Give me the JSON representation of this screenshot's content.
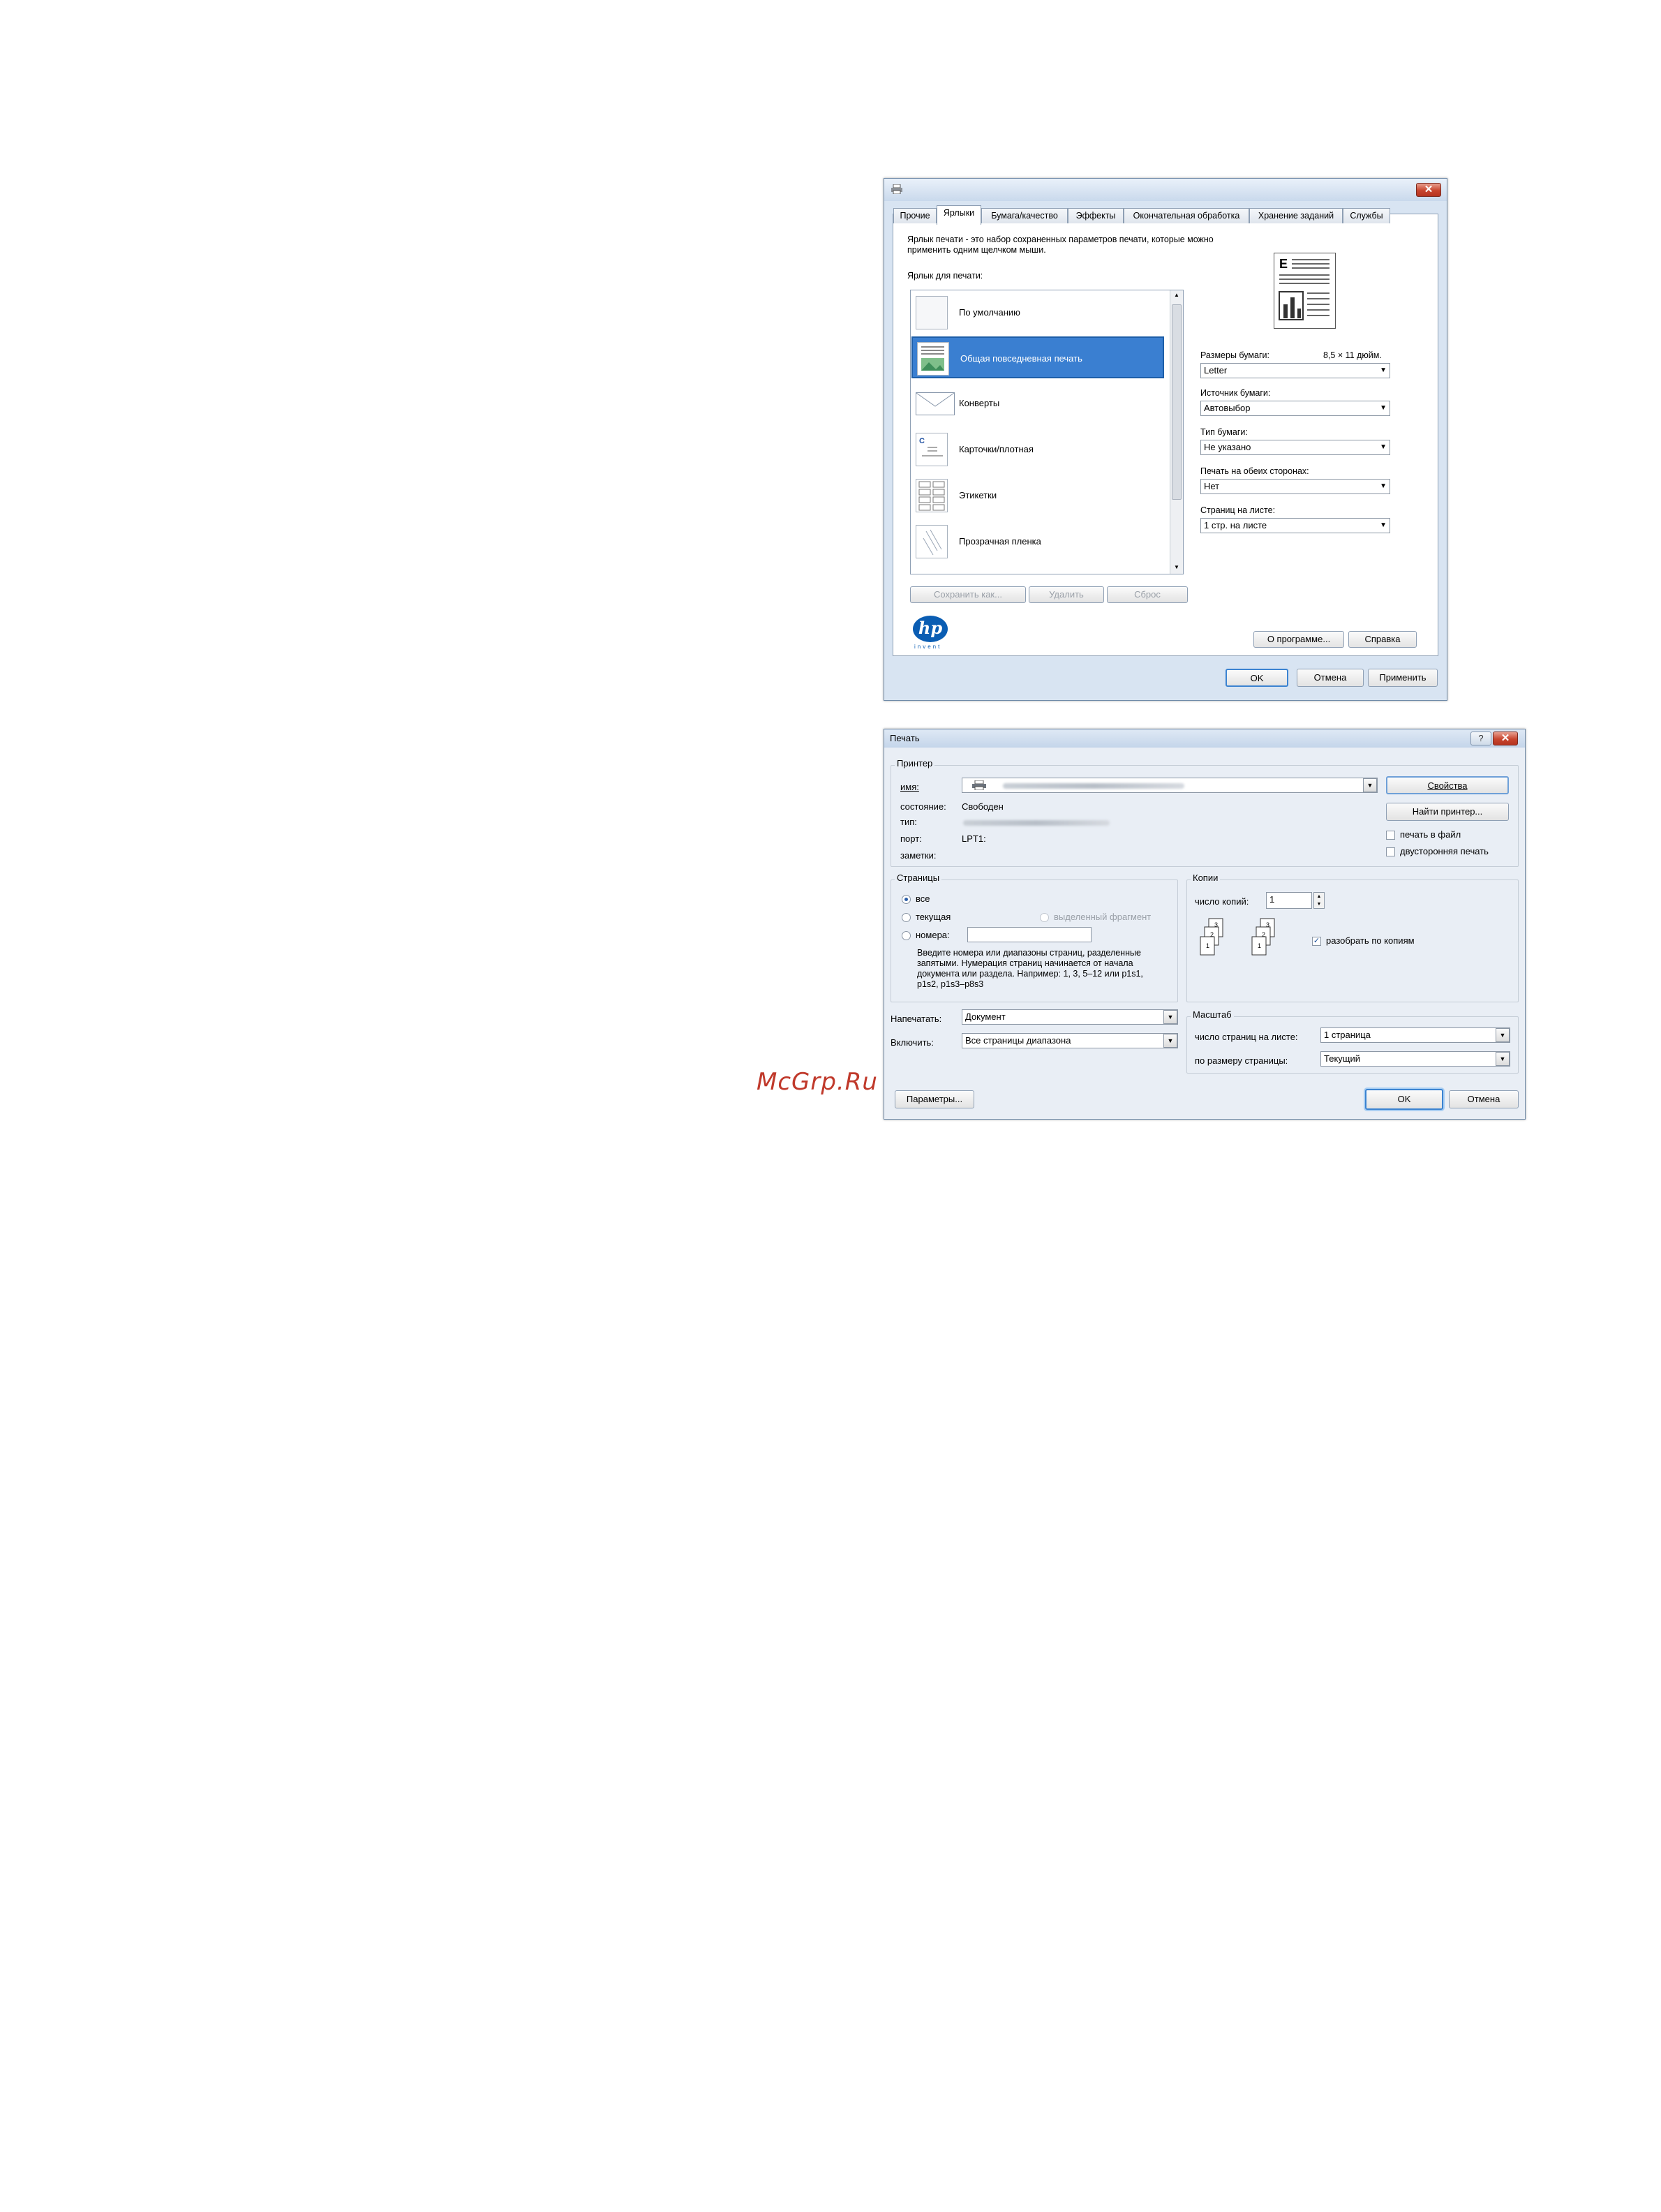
{
  "watermark": "McGrp.Ru",
  "hp_dialog": {
    "tabs": [
      "Прочие",
      "Ярлыки",
      "Бумага/качество",
      "Эффекты",
      "Окончательная обработка",
      "Хранение заданий",
      "Службы"
    ],
    "active_tab": "Ярлыки",
    "description": "Ярлык печати - это набор сохраненных параметров печати, которые можно применить одним щелчком мыши.",
    "shortcuts_label": "Ярлык для печати:",
    "shortcuts": [
      {
        "label": "По умолчанию",
        "icon": "blank-page-icon"
      },
      {
        "label": "Общая повседневная печать",
        "icon": "document-photo-icon",
        "selected": true
      },
      {
        "label": "Конверты",
        "icon": "envelope-icon"
      },
      {
        "label": "Карточки/плотная",
        "icon": "card-icon"
      },
      {
        "label": "Этикетки",
        "icon": "labels-icon"
      },
      {
        "label": "Прозрачная пленка",
        "icon": "transparency-icon"
      }
    ],
    "paper_size_label": "Размеры бумаги:",
    "paper_size_value": "8,5 × 11 дюйм.",
    "paper_size": "Letter",
    "paper_source_label": "Источник бумаги:",
    "paper_source": "Автовыбор",
    "paper_type_label": "Тип бумаги:",
    "paper_type": "Не указано",
    "duplex_label": "Печать на обеих сторонах:",
    "duplex": "Нет",
    "pages_per_sheet_label": "Страниц на листе:",
    "pages_per_sheet": "1 стр. на листе",
    "save_as": "Сохранить как...",
    "delete": "Удалить",
    "reset": "Сброс",
    "hp_logo": "hp",
    "hp_logo_tagline": "invent",
    "about": "О программе...",
    "help": "Справка",
    "ok": "OK",
    "cancel": "Отмена",
    "apply": "Применить"
  },
  "print_dialog": {
    "title": "Печать",
    "help_icon": "?",
    "close_icon": "✕",
    "printer_group": "Принтер",
    "name_label": "имя:",
    "status_label": "состояние:",
    "status_value": "Свободен",
    "type_label": "тип:",
    "port_label": "порт:",
    "port_value": "LPT1:",
    "notes_label": "заметки:",
    "properties": "Свойства",
    "find_printer": "Найти принтер...",
    "print_to_file": "печать в файл",
    "duplex_print": "двусторонняя печать",
    "pages_group": "Страницы",
    "all": "все",
    "current": "текущая",
    "selection": "выделенный фрагмент",
    "numbers": "номера:",
    "hint": "Введите номера или диапазоны страниц, разделенные запятыми. Нумерация страниц начинается от начала документа или раздела. Например: 1, 3, 5–12 или p1s1, p1s2, p1s3–p8s3",
    "copies_group": "Копии",
    "copies_label": "число копий:",
    "copies_value": "1",
    "collate": "разобрать по копиям",
    "print_what_label": "Напечатать:",
    "print_what": "Документ",
    "include_label": "Включить:",
    "include": "Все страницы диапазона",
    "zoom_group": "Масштаб",
    "pages_per_sheet_label": "число страниц на листе:",
    "pages_per_sheet": "1 страница",
    "scale_label": "по размеру страницы:",
    "scale": "Текущий",
    "options": "Параметры...",
    "ok": "OK",
    "cancel": "Отмена"
  }
}
